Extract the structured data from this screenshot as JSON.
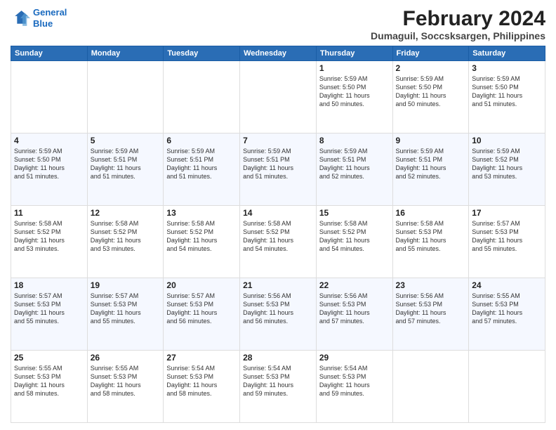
{
  "logo": {
    "line1": "General",
    "line2": "Blue"
  },
  "title": "February 2024",
  "subtitle": "Dumaguil, Soccsksargen, Philippines",
  "days_header": [
    "Sunday",
    "Monday",
    "Tuesday",
    "Wednesday",
    "Thursday",
    "Friday",
    "Saturday"
  ],
  "weeks": [
    [
      {
        "day": "",
        "info": ""
      },
      {
        "day": "",
        "info": ""
      },
      {
        "day": "",
        "info": ""
      },
      {
        "day": "",
        "info": ""
      },
      {
        "day": "1",
        "info": "Sunrise: 5:59 AM\nSunset: 5:50 PM\nDaylight: 11 hours\nand 50 minutes."
      },
      {
        "day": "2",
        "info": "Sunrise: 5:59 AM\nSunset: 5:50 PM\nDaylight: 11 hours\nand 50 minutes."
      },
      {
        "day": "3",
        "info": "Sunrise: 5:59 AM\nSunset: 5:50 PM\nDaylight: 11 hours\nand 51 minutes."
      }
    ],
    [
      {
        "day": "4",
        "info": "Sunrise: 5:59 AM\nSunset: 5:50 PM\nDaylight: 11 hours\nand 51 minutes."
      },
      {
        "day": "5",
        "info": "Sunrise: 5:59 AM\nSunset: 5:51 PM\nDaylight: 11 hours\nand 51 minutes."
      },
      {
        "day": "6",
        "info": "Sunrise: 5:59 AM\nSunset: 5:51 PM\nDaylight: 11 hours\nand 51 minutes."
      },
      {
        "day": "7",
        "info": "Sunrise: 5:59 AM\nSunset: 5:51 PM\nDaylight: 11 hours\nand 51 minutes."
      },
      {
        "day": "8",
        "info": "Sunrise: 5:59 AM\nSunset: 5:51 PM\nDaylight: 11 hours\nand 52 minutes."
      },
      {
        "day": "9",
        "info": "Sunrise: 5:59 AM\nSunset: 5:51 PM\nDaylight: 11 hours\nand 52 minutes."
      },
      {
        "day": "10",
        "info": "Sunrise: 5:59 AM\nSunset: 5:52 PM\nDaylight: 11 hours\nand 53 minutes."
      }
    ],
    [
      {
        "day": "11",
        "info": "Sunrise: 5:58 AM\nSunset: 5:52 PM\nDaylight: 11 hours\nand 53 minutes."
      },
      {
        "day": "12",
        "info": "Sunrise: 5:58 AM\nSunset: 5:52 PM\nDaylight: 11 hours\nand 53 minutes."
      },
      {
        "day": "13",
        "info": "Sunrise: 5:58 AM\nSunset: 5:52 PM\nDaylight: 11 hours\nand 54 minutes."
      },
      {
        "day": "14",
        "info": "Sunrise: 5:58 AM\nSunset: 5:52 PM\nDaylight: 11 hours\nand 54 minutes."
      },
      {
        "day": "15",
        "info": "Sunrise: 5:58 AM\nSunset: 5:52 PM\nDaylight: 11 hours\nand 54 minutes."
      },
      {
        "day": "16",
        "info": "Sunrise: 5:58 AM\nSunset: 5:53 PM\nDaylight: 11 hours\nand 55 minutes."
      },
      {
        "day": "17",
        "info": "Sunrise: 5:57 AM\nSunset: 5:53 PM\nDaylight: 11 hours\nand 55 minutes."
      }
    ],
    [
      {
        "day": "18",
        "info": "Sunrise: 5:57 AM\nSunset: 5:53 PM\nDaylight: 11 hours\nand 55 minutes."
      },
      {
        "day": "19",
        "info": "Sunrise: 5:57 AM\nSunset: 5:53 PM\nDaylight: 11 hours\nand 55 minutes."
      },
      {
        "day": "20",
        "info": "Sunrise: 5:57 AM\nSunset: 5:53 PM\nDaylight: 11 hours\nand 56 minutes."
      },
      {
        "day": "21",
        "info": "Sunrise: 5:56 AM\nSunset: 5:53 PM\nDaylight: 11 hours\nand 56 minutes."
      },
      {
        "day": "22",
        "info": "Sunrise: 5:56 AM\nSunset: 5:53 PM\nDaylight: 11 hours\nand 57 minutes."
      },
      {
        "day": "23",
        "info": "Sunrise: 5:56 AM\nSunset: 5:53 PM\nDaylight: 11 hours\nand 57 minutes."
      },
      {
        "day": "24",
        "info": "Sunrise: 5:55 AM\nSunset: 5:53 PM\nDaylight: 11 hours\nand 57 minutes."
      }
    ],
    [
      {
        "day": "25",
        "info": "Sunrise: 5:55 AM\nSunset: 5:53 PM\nDaylight: 11 hours\nand 58 minutes."
      },
      {
        "day": "26",
        "info": "Sunrise: 5:55 AM\nSunset: 5:53 PM\nDaylight: 11 hours\nand 58 minutes."
      },
      {
        "day": "27",
        "info": "Sunrise: 5:54 AM\nSunset: 5:53 PM\nDaylight: 11 hours\nand 58 minutes."
      },
      {
        "day": "28",
        "info": "Sunrise: 5:54 AM\nSunset: 5:53 PM\nDaylight: 11 hours\nand 59 minutes."
      },
      {
        "day": "29",
        "info": "Sunrise: 5:54 AM\nSunset: 5:53 PM\nDaylight: 11 hours\nand 59 minutes."
      },
      {
        "day": "",
        "info": ""
      },
      {
        "day": "",
        "info": ""
      }
    ]
  ]
}
